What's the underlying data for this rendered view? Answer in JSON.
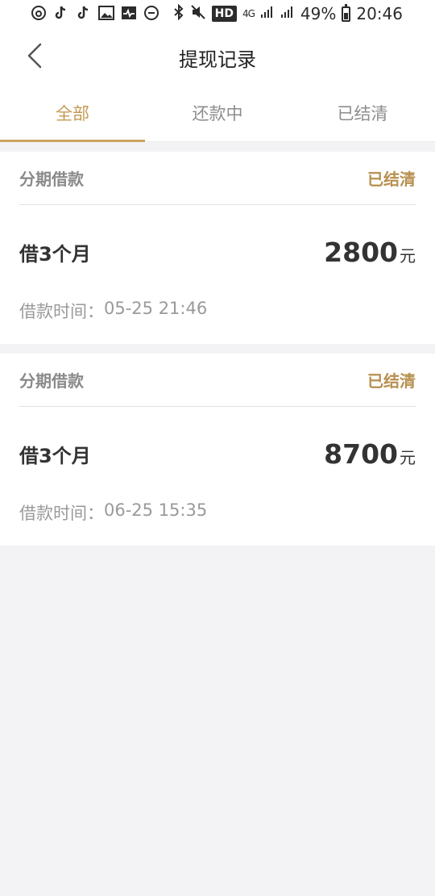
{
  "status_bar": {
    "left_icons": [
      "netease-music-icon",
      "tiktok-icon",
      "tiktok-icon",
      "gallery-icon",
      "health-icon",
      "do-not-disturb-icon"
    ],
    "hd_label": "HD",
    "network_label": "4G",
    "battery_percent": "49%",
    "time": "20:46"
  },
  "header": {
    "title": "提现记录"
  },
  "tabs": [
    {
      "label": "全部",
      "active": true
    },
    {
      "label": "还款中",
      "active": false
    },
    {
      "label": "已结清",
      "active": false
    }
  ],
  "records": [
    {
      "type": "分期借款",
      "status": "已结清",
      "term": "借3个月",
      "amount": "2800",
      "unit": "元",
      "time_label": "借款时间：",
      "time_value": "05-25 21:46"
    },
    {
      "type": "分期借款",
      "status": "已结清",
      "term": "借3个月",
      "amount": "8700",
      "unit": "元",
      "time_label": "借款时间：",
      "time_value": "06-25 15:35"
    }
  ],
  "colors": {
    "accent": "#c49a54",
    "status_text": "#b7904f",
    "background": "#f3f3f6"
  }
}
